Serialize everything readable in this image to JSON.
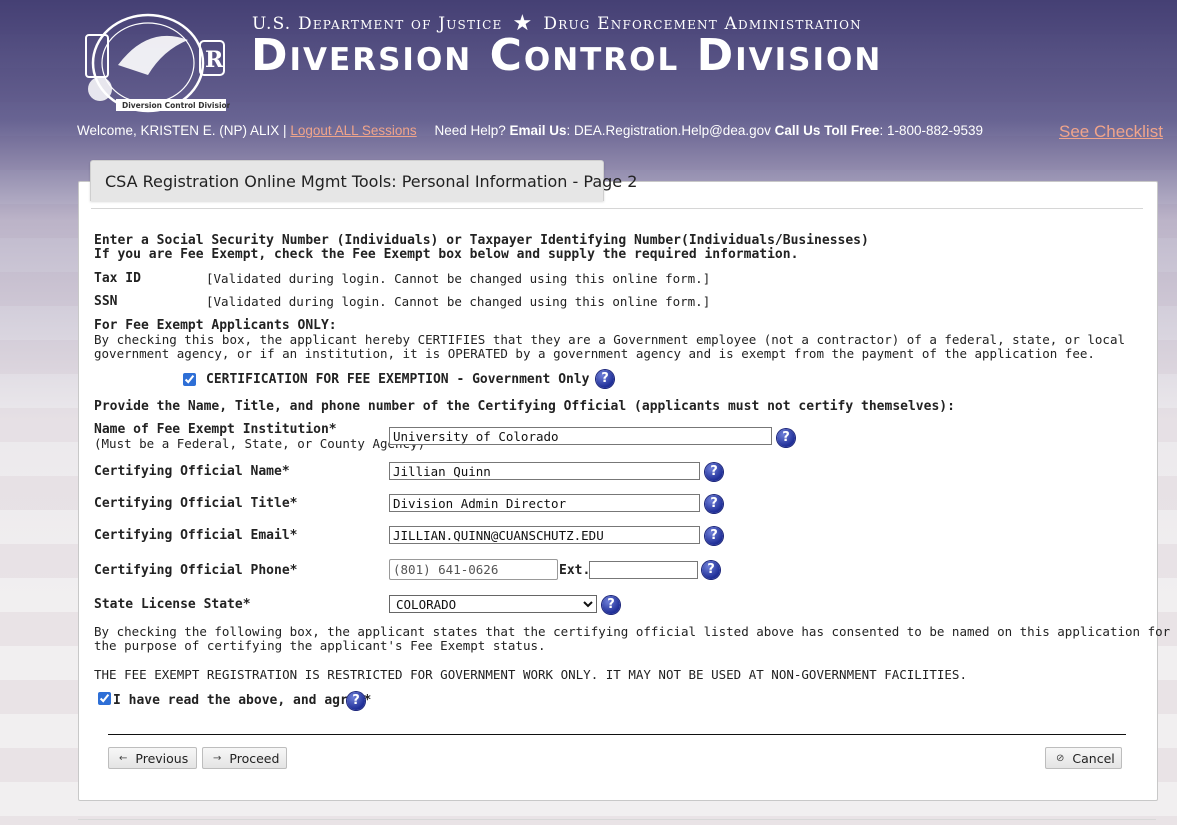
{
  "header": {
    "logo_text": "U.S. Department of Justice · Drug Enforcement Administration · Diversion Control Division",
    "agency_left": "U.S. Department of Justice",
    "agency_right": "Drug Enforcement Administration",
    "division_title": "Diversion Control Division"
  },
  "welcome": {
    "prefix": "Welcome, KRISTEN E. (NP) ALIX |",
    "logout_label": "Logout ALL Sessions",
    "need_help": "Need Help?",
    "email_label": "Email Us",
    "email_value": ": DEA.Registration.Help@dea.gov",
    "call_label": "Call Us",
    "tollfree_label": "Toll Free",
    "phone_value": ": 1-800-882-9539",
    "checklist_link": "See Checklist"
  },
  "page": {
    "tab_title": "CSA Registration Online Mgmt Tools: Personal Information - Page 2",
    "intro_line1": "Enter a Social Security Number (Individuals) or Taxpayer Identifying Number(Individuals/Businesses)",
    "intro_line2": "If you are Fee Exempt, check the Fee Exempt box below and supply the required information.",
    "tax_id_label": "Tax ID",
    "tax_id_value": "[Validated during login. Cannot be changed using this online form.]",
    "ssn_label": "SSN",
    "ssn_value": "[Validated during login. Cannot be changed using this online form.]",
    "fee_exempt_heading": "For Fee Exempt Applicants ONLY:",
    "fee_exempt_text1": "By checking this box, the applicant hereby CERTIFIES that they are a Government employee (not a contractor) of a federal, state, or local",
    "fee_exempt_text2": "government agency, or if an institution, it is OPERATED by a government agency and is exempt from the payment of the application fee.",
    "certification_label": "CERTIFICATION FOR FEE EXEMPTION - Government Only",
    "certification_checked": true,
    "provide_heading": "Provide the Name, Title, and phone number of the Certifying Official (applicants must not certify themselves):"
  },
  "form": {
    "institution_label": "Name of Fee Exempt Institution*",
    "institution_sublabel": "(Must be a Federal, State, or County Agency)",
    "institution_value": "University of Colorado",
    "official_name_label": "Certifying Official Name*",
    "official_name_value": "Jillian Quinn",
    "official_title_label": "Certifying Official Title*",
    "official_title_value": "Division Admin Director",
    "official_email_label": "Certifying Official Email*",
    "official_email_value": "JILLIAN.QUINN@CUANSCHUTZ.EDU",
    "official_phone_label": "Certifying Official Phone*",
    "official_phone_placeholder": "(801) 641-0626",
    "ext_label": "Ext.",
    "ext_value": "",
    "state_label": "State License State*",
    "state_value": "COLORADO",
    "help_glyph": "?"
  },
  "consent": {
    "text1": "By checking the following box, the applicant states that the certifying official listed above has consented to be named on this application for",
    "text2": "the purpose of certifying the applicant's Fee Exempt status.",
    "restriction": "THE FEE EXEMPT REGISTRATION IS RESTRICTED FOR GOVERNMENT WORK ONLY. IT MAY NOT BE USED AT NON-GOVERNMENT FACILITIES.",
    "agree_label": "I have read the above, and agree*",
    "agree_checked": true
  },
  "buttons": {
    "previous": "Previous",
    "proceed": "Proceed",
    "cancel": "Cancel",
    "previous_icon": "arrow-left-icon",
    "proceed_icon": "arrow-right-icon",
    "cancel_icon": "cancel-icon"
  },
  "colors": {
    "link": "#f0a48a",
    "help_icon": "#1f2e97",
    "header_bg": "#3c376e"
  }
}
